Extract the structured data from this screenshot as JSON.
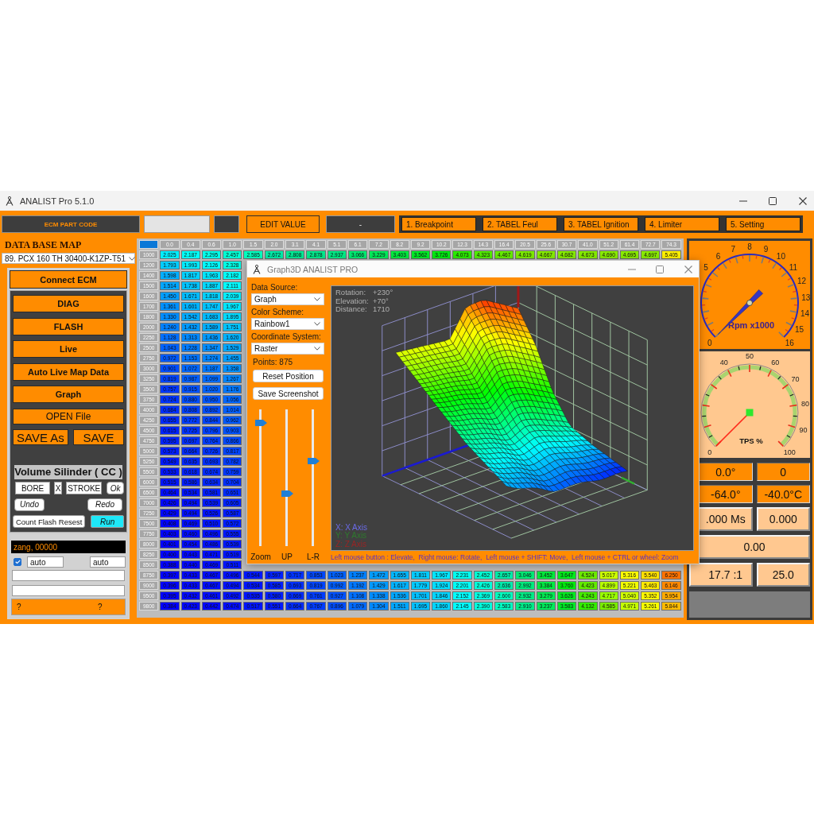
{
  "window": {
    "title": "ANALIST Pro 5.1.0"
  },
  "toolbar": {
    "part_code_button": "ECM PART CODE",
    "edit_button": "EDIT VALUE",
    "value_display": "-",
    "menu": [
      "1. Breakpoint",
      "2. TABEL Feul",
      "3. TABEL Ignition",
      "4. Limiter",
      "5. Setting"
    ]
  },
  "sidebar": {
    "heading": "DATA BASE MAP",
    "database": "89. PCX 160 TH 30400-K1ZP-T51",
    "connect_button": "Connect ECM",
    "buttons": [
      "DIAG",
      "FLASH",
      "Live",
      "Auto Live Map Data",
      "Graph"
    ],
    "open_button": "OPEN File",
    "save_buttons": [
      "SAVE As",
      "SAVE"
    ],
    "volume": {
      "title": "Volume Silinder ( CC )",
      "bore": "BORE",
      "times": "X",
      "stroke": "STROKE",
      "ok": "Ok"
    },
    "undo": "Undo",
    "redo": "Redo",
    "count_button": "Count Flash Resest",
    "run_button": "Run",
    "console": "zang, 00000",
    "auto_checked": true,
    "auto_fields": [
      "auto",
      "auto"
    ],
    "footer": [
      "?",
      "?"
    ]
  },
  "table": {
    "columns": [
      "0.0",
      "0.4",
      "0.6",
      "1.0",
      "1.5",
      "2.0",
      "3.1",
      "4.1",
      "5.1",
      "6.1",
      "7.2",
      "8.2",
      "9.2",
      "10.2",
      "12.3",
      "14.3",
      "16.4",
      "20.5",
      "25.6",
      "30.7",
      "41.0",
      "51.2",
      "61.4",
      "72.7",
      "74.3"
    ],
    "rows": [
      {
        "label": "1000",
        "cells": [
          "2.025",
          "2.187",
          "2.295",
          "2.457",
          "2.585",
          "2.672",
          "2.808",
          "2.878",
          "2.937",
          "3.066",
          "3.229",
          "3.403",
          "3.562",
          "3.726",
          "4.073",
          "4.323",
          "4.467",
          "4.619",
          "4.667",
          "4.682",
          "4.673",
          "4.690",
          "4.695",
          "4.697",
          "5.405"
        ]
      },
      {
        "label": "1200",
        "cells": [
          "1.793",
          "1.993",
          "2.126",
          "2.328"
        ]
      },
      {
        "label": "1400",
        "cells": [
          "1.598",
          "1.817",
          "1.963",
          "2.182"
        ]
      },
      {
        "label": "1500",
        "cells": [
          "1.514",
          "1.738",
          "1.887",
          "2.111"
        ]
      },
      {
        "label": "1600",
        "cells": [
          "1.450",
          "1.671",
          "1.818",
          "2.039"
        ]
      },
      {
        "label": "1700",
        "cells": [
          "1.361",
          "1.601",
          "1.747",
          "1.967"
        ]
      },
      {
        "label": "1800",
        "cells": [
          "1.330",
          "1.542",
          "1.683",
          "1.895"
        ]
      },
      {
        "label": "2000",
        "cells": [
          "1.240",
          "1.432",
          "1.589",
          "1.751"
        ]
      },
      {
        "label": "2250",
        "cells": [
          "1.128",
          "1.313",
          "1.436",
          "1.620"
        ]
      },
      {
        "label": "2500",
        "cells": [
          "1.043",
          "1.228",
          "1.347",
          "1.529"
        ]
      },
      {
        "label": "2750",
        "cells": [
          "0.972",
          "1.153",
          "1.274",
          "1.455"
        ]
      },
      {
        "label": "3000",
        "cells": [
          "0.901",
          "1.072",
          "1.187",
          "1.358"
        ]
      },
      {
        "label": "3250",
        "cells": [
          "0.819",
          "0.987",
          "1.099",
          "1.267"
        ]
      },
      {
        "label": "3500",
        "cells": [
          "0.757",
          "0.915",
          "1.020",
          "1.176"
        ]
      },
      {
        "label": "3750",
        "cells": [
          "0.724",
          "0.880",
          "0.950",
          "1.056"
        ]
      },
      {
        "label": "4000",
        "cells": [
          "0.684",
          "0.808",
          "0.892",
          "1.014"
        ]
      },
      {
        "label": "4250",
        "cells": [
          "0.655",
          "0.772",
          "0.844",
          "0.962"
        ]
      },
      {
        "label": "4500",
        "cells": [
          "0.615",
          "0.725",
          "0.796",
          "0.903"
        ]
      },
      {
        "label": "4750",
        "cells": [
          "0.595",
          "0.697",
          "0.764",
          "0.866"
        ]
      },
      {
        "label": "5000",
        "cells": [
          "0.573",
          "0.664",
          "0.726",
          "0.817"
        ]
      },
      {
        "label": "5250",
        "cells": [
          "0.549",
          "0.635",
          "0.693",
          "0.782"
        ]
      },
      {
        "label": "5500",
        "cells": [
          "0.533",
          "0.618",
          "0.674",
          "0.759"
        ]
      },
      {
        "label": "6000",
        "cells": [
          "0.515",
          "0.586",
          "0.634",
          "0.704"
        ]
      },
      {
        "label": "6500",
        "cells": [
          "0.464",
          "0.534",
          "0.581",
          "0.651"
        ]
      },
      {
        "label": "7000",
        "cells": [
          "0.426",
          "0.494",
          "0.539",
          "0.605"
        ]
      },
      {
        "label": "7250",
        "cells": [
          "0.429",
          "0.494",
          "0.526",
          "0.587"
        ]
      },
      {
        "label": "7500",
        "cells": [
          "0.408",
          "0.469",
          "0.510",
          "0.572"
        ]
      },
      {
        "label": "7750",
        "cells": [
          "0.403",
          "0.460",
          "0.496",
          "0.555"
        ]
      },
      {
        "label": "8000",
        "cells": [
          "0.401",
          "0.454",
          "0.486",
          "0.539"
        ]
      },
      {
        "label": "8250",
        "cells": [
          "0.400",
          "0.443",
          "0.471",
          "0.519"
        ]
      },
      {
        "label": "8500",
        "cells": [
          "0.388",
          "0.440",
          "0.469",
          "0.511"
        ]
      },
      {
        "label": "8750",
        "cells": [
          "0.397",
          "0.433",
          "0.467",
          "0.496",
          "0.544",
          "0.597",
          "0.717",
          "0.853",
          "1.023",
          "1.237",
          "1.472",
          "1.655",
          "1.811",
          "1.967",
          "2.231",
          "2.452",
          "2.657",
          "3.046",
          "3.452",
          "3.647",
          "4.524",
          "5.017",
          "5.316",
          "5.540",
          "6.250"
        ]
      },
      {
        "label": "9000",
        "cells": [
          "0.396",
          "0.433",
          "0.467",
          "0.494",
          "0.534",
          "0.585",
          "0.693",
          "0.819",
          "0.992",
          "1.192",
          "1.429",
          "1.617",
          "1.779",
          "1.924",
          "2.201",
          "2.426",
          "2.636",
          "2.992",
          "3.384",
          "3.760",
          "4.423",
          "4.899",
          "5.221",
          "5.463",
          "6.146"
        ]
      },
      {
        "label": "9500",
        "cells": [
          "0.395",
          "0.432",
          "0.461",
          "0.492",
          "0.535",
          "0.580",
          "0.669",
          "0.761",
          "0.927",
          "1.108",
          "1.338",
          "1.536",
          "1.701",
          "1.846",
          "2.152",
          "2.369",
          "2.600",
          "2.932",
          "3.279",
          "3.626",
          "4.243",
          "4.717",
          "5.040",
          "5.352",
          "5.954"
        ]
      },
      {
        "label": "9800",
        "cells": [
          "0.384",
          "0.423",
          "0.442",
          "0.474",
          "0.517",
          "0.551",
          "0.664",
          "0.767",
          "0.896",
          "1.079",
          "1.304",
          "1.511",
          "1.695",
          "1.860",
          "2.145",
          "2.390",
          "2.583",
          "2.910",
          "3.237",
          "3.583",
          "4.132",
          "4.585",
          "4.971",
          "5.261",
          "5.844"
        ]
      }
    ]
  },
  "instruments": {
    "gauges": [
      {
        "kind": "rpm",
        "title": "Rpm x1000",
        "labels": [
          "0",
          "5",
          "6",
          "7",
          "8",
          "9",
          "10",
          "11",
          "12",
          "13",
          "14",
          "15",
          "16"
        ]
      },
      {
        "kind": "tps",
        "title": "TPS %",
        "labels": [
          "0",
          "40",
          "50",
          "60",
          "70",
          "80",
          "90",
          "100"
        ]
      }
    ],
    "readouts": [
      {
        "kind": "highlight",
        "cells": [
          "0.0°",
          "0"
        ]
      },
      {
        "kind": "highlight",
        "cells": [
          "-64.0°",
          "-40.0°C"
        ]
      },
      {
        "kind": "plain",
        "cells": [
          ".000 Ms",
          "0.000"
        ]
      },
      {
        "kind": "plain",
        "cells": [
          "0.00"
        ]
      },
      {
        "kind": "plain",
        "cells": [
          "17.7 :1",
          "25.0"
        ]
      }
    ]
  },
  "graph_window": {
    "title": "Graph3D ANALIST PRO",
    "fields": [
      {
        "label": "Data Source:",
        "value": "Graph"
      },
      {
        "label": "Color Scheme:",
        "value": "Rainbow1"
      },
      {
        "label": "Coordinate System:",
        "value": "Raster"
      }
    ],
    "points": "Points: 875",
    "buttons": [
      "Reset Position",
      "Save Screenshot"
    ],
    "sliders": [
      {
        "label": "Zoom",
        "level": 0.92
      },
      {
        "label": "UP",
        "level": 0.38
      },
      {
        "label": "L-R",
        "level": 0.63
      }
    ],
    "view": [
      {
        "label": "Rotation:",
        "value": "+230°"
      },
      {
        "label": "Elevation:",
        "value": "+70°"
      },
      {
        "label": "Distance:",
        "value": "1710"
      }
    ],
    "legend": [
      {
        "text": "X: X Axis",
        "color": "#6a6ae6"
      },
      {
        "text": "Y: Y Axis",
        "color": "#2e7a2e"
      },
      {
        "text": "Z: Z Axis",
        "color": "#9a2424"
      }
    ],
    "hint": "Left mouse button : Elevate,  Right mouse: Rotate,  Left mouse + SHIFT: Move,  Left mouse + CTRL or wheel: Zoom"
  }
}
